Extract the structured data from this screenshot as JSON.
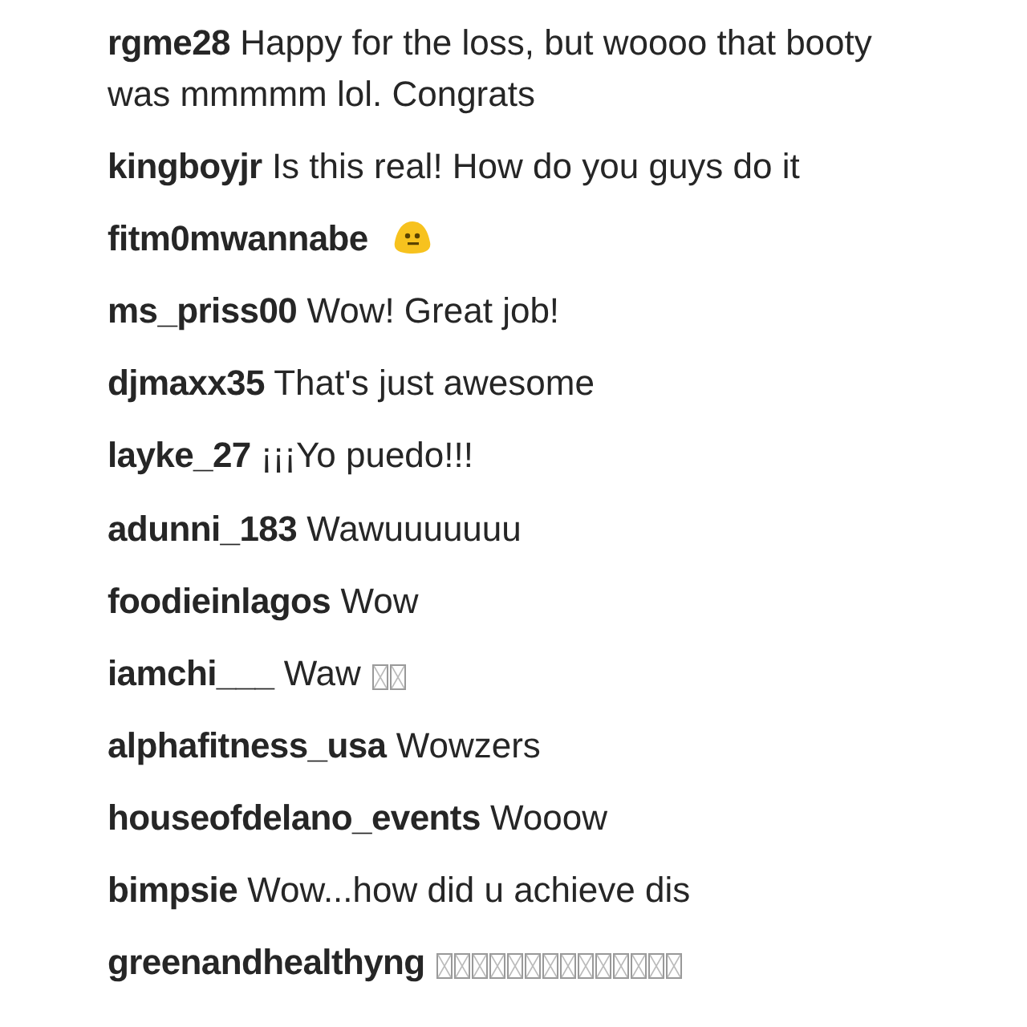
{
  "groups": [
    {
      "comments": [
        {
          "user": "rgme28",
          "text": "Happy for the loss, but woooo that booty was mmmmm lol. Congrats"
        },
        {
          "user": "kingboyjr",
          "text": "Is this real! How do you guys do it"
        },
        {
          "user": "fitm0mwannabe",
          "extras": [
            {
              "kind": "emoji"
            }
          ]
        },
        {
          "user": "ms_priss00",
          "text": "Wow! Great job!"
        },
        {
          "user": "djmaxx35",
          "text": "That's just awesome"
        },
        {
          "user": "layke_27",
          "text": "¡¡¡Yo puedo!!!"
        }
      ]
    },
    {
      "comments": [
        {
          "user": "adunni_183",
          "text": "Wawuuuuuuu"
        },
        {
          "user": "foodieinlagos",
          "text": "Wow"
        },
        {
          "user": "iamchi___",
          "text": "Waw",
          "extras": [
            {
              "kind": "missing"
            },
            {
              "kind": "missing"
            }
          ]
        },
        {
          "user": "alphafitness_usa",
          "text": "Wowzers"
        },
        {
          "user": "houseofdelano_events",
          "text": "Wooow"
        },
        {
          "user": "bimpsie",
          "text": "Wow...how did u achieve dis"
        },
        {
          "user": "greenandhealthyng",
          "extras": [
            {
              "kind": "missing"
            },
            {
              "kind": "missing"
            },
            {
              "kind": "missing"
            },
            {
              "kind": "missing"
            },
            {
              "kind": "missing"
            },
            {
              "kind": "missing"
            },
            {
              "kind": "missing"
            },
            {
              "kind": "missing"
            },
            {
              "kind": "missing"
            },
            {
              "kind": "missing"
            },
            {
              "kind": "missing"
            },
            {
              "kind": "missing"
            },
            {
              "kind": "missing"
            },
            {
              "kind": "missing"
            }
          ]
        }
      ]
    }
  ]
}
